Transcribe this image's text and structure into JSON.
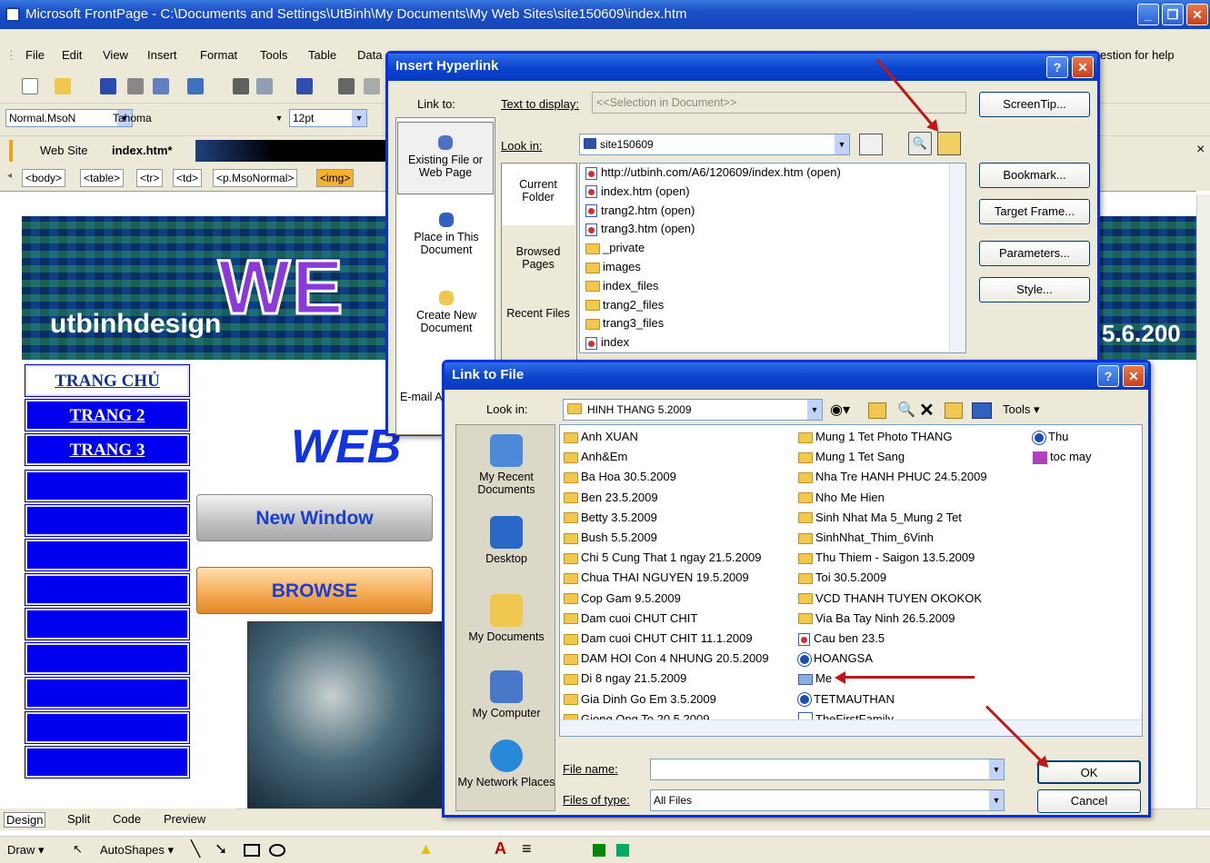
{
  "window": {
    "title": "Microsoft FrontPage - C:\\Documents and Settings\\UtBinh\\My Documents\\My Web Sites\\site150609\\index.htm"
  },
  "menu": [
    "File",
    "Edit",
    "View",
    "Insert",
    "Format",
    "Tools",
    "Table",
    "Data"
  ],
  "help_hint": "estion for help",
  "format_bar": {
    "style": "Normal.MsoN",
    "font": "Tahoma",
    "size": "12pt"
  },
  "doc_tabs": {
    "web_site": "Web Site",
    "active": "index.htm*"
  },
  "tag_path": [
    "<body>",
    "<table>",
    "<tr>",
    "<td>",
    "<p.MsoNormal>",
    "<img>"
  ],
  "page": {
    "banner_word": "WE",
    "brand": "utbinhdesign",
    "banner_date": "5.6.200",
    "nav": [
      "TRANG CHỦ",
      "TRANG 2",
      "TRANG 3"
    ],
    "headline": "WEB",
    "new_window": "New Window",
    "browse": "BROWSE"
  },
  "view_tabs": [
    "Design",
    "Split",
    "Code",
    "Preview"
  ],
  "draw_bar": {
    "draw": "Draw ▾",
    "autoshapes": "AutoShapes ▾"
  },
  "insert_hyperlink": {
    "title": "Insert Hyperlink",
    "link_to_label": "Link to:",
    "text_to_display_label": "Text to display:",
    "text_to_display_value": "<<Selection in Document>>",
    "screentip": "ScreenTip...",
    "look_in_label": "Look in:",
    "look_in_value": "site150609",
    "link_to_options": [
      "Existing File or Web Page",
      "Place in This Document",
      "Create New Document",
      "E-mail A"
    ],
    "sub_tabs": [
      "Current Folder",
      "Browsed Pages",
      "Recent Files"
    ],
    "files": [
      {
        "name": "http://utbinh.com/A6/120609/index.htm (open)",
        "type": "page"
      },
      {
        "name": "index.htm (open)",
        "type": "page"
      },
      {
        "name": "trang2.htm (open)",
        "type": "page"
      },
      {
        "name": "trang3.htm (open)",
        "type": "page"
      },
      {
        "name": "_private",
        "type": "folder"
      },
      {
        "name": "images",
        "type": "folder"
      },
      {
        "name": "index_files",
        "type": "folder"
      },
      {
        "name": "trang2_files",
        "type": "folder"
      },
      {
        "name": "trang3_files",
        "type": "folder"
      },
      {
        "name": "index",
        "type": "page"
      }
    ],
    "buttons": [
      "Bookmark...",
      "Target Frame...",
      "Parameters...",
      "Style..."
    ]
  },
  "link_to_file": {
    "title": "Link to File",
    "look_in_label": "Look in:",
    "look_in_value": "HINH THANG 5.2009",
    "tools": "Tools ▾",
    "places": [
      "My Recent Documents",
      "Desktop",
      "My Documents",
      "My Computer",
      "My Network Places"
    ],
    "col1": [
      "Anh XUAN",
      "Anh&Em",
      "Ba Hoa 30.5.2009",
      "Ben 23.5.2009",
      "Betty 3.5.2009",
      "Bush 5.5.2009",
      "Chi 5 Cung That 1 ngay  21.5.2009",
      "Chua THAI NGUYEN 19.5.2009",
      "Cop Gam 9.5.2009",
      "Dam cuoi CHUT CHIT",
      "Dam cuoi CHUT CHIT 11.1.2009",
      "DAM HOI Con 4 NHUNG 20.5.2009",
      "Di 8 ngay 21.5.2009",
      "Gia Dinh Go Em 3.5.2009",
      "Giong Ong To 20.5.2009"
    ],
    "col2": [
      {
        "name": "Mung 1 Tet  Photo THANG",
        "type": "folder"
      },
      {
        "name": "Mung 1 Tet Sang",
        "type": "folder"
      },
      {
        "name": "Nha Tre HANH PHUC 24.5.2009",
        "type": "folder"
      },
      {
        "name": "Nho Me Hien",
        "type": "folder"
      },
      {
        "name": "Sinh Nhat Ma 5_Mung 2 Tet",
        "type": "folder"
      },
      {
        "name": "SinhNhat_Thim_6Vinh",
        "type": "folder"
      },
      {
        "name": "Thu Thiem - Saigon 13.5.2009",
        "type": "folder"
      },
      {
        "name": "Toi 30.5.2009",
        "type": "folder"
      },
      {
        "name": "VCD THANH TUYEN OKOKOK",
        "type": "folder"
      },
      {
        "name": "Via Ba Tay Ninh 26.5.2009",
        "type": "folder"
      },
      {
        "name": "Cau ben 23.5",
        "type": "file"
      },
      {
        "name": "HOANGSA",
        "type": "media"
      },
      {
        "name": "Me",
        "type": "image"
      },
      {
        "name": "TETMAUTHAN",
        "type": "media"
      },
      {
        "name": "TheFirstFamily",
        "type": "doc"
      }
    ],
    "col3": [
      {
        "name": "Thu",
        "type": "media"
      },
      {
        "name": "toc may",
        "type": "app"
      }
    ],
    "file_name_label": "File name:",
    "file_name_value": "",
    "files_of_type_label": "Files of type:",
    "files_of_type_value": "All Files",
    "ok": "OK",
    "cancel": "Cancel"
  }
}
